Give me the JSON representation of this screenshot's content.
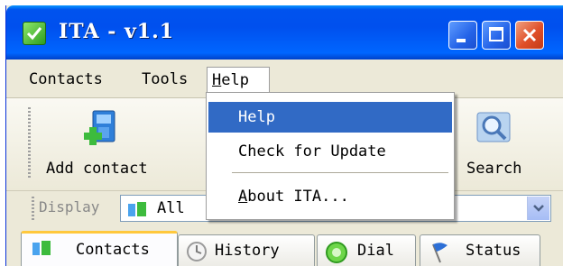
{
  "window": {
    "title": "ITA - v1.1"
  },
  "menubar": {
    "items": [
      {
        "label": "Contacts"
      },
      {
        "label": "Tools"
      },
      {
        "label_first": "H",
        "label_rest": "elp"
      }
    ]
  },
  "help_menu": {
    "items": [
      {
        "label": "Help",
        "highlighted": true
      },
      {
        "label": "Check for Update"
      },
      {
        "label_first": "A",
        "label_rest": "bout ITA..."
      }
    ]
  },
  "toolbar": {
    "add_contact_label": "Add contact",
    "search_label": "Search"
  },
  "display": {
    "label": "Display",
    "selected_value": "All"
  },
  "tabs": [
    {
      "label": "Contacts",
      "active": true,
      "icon": "contacts-icon"
    },
    {
      "label": "History",
      "icon": "clock-icon"
    },
    {
      "label": "Dial",
      "icon": "dial-icon"
    },
    {
      "label": "Status",
      "icon": "flag-icon"
    }
  ],
  "colors": {
    "titlebar": "#0053ee",
    "menu_highlight": "#316ac5",
    "active_tab_accent": "#ffc83c"
  }
}
